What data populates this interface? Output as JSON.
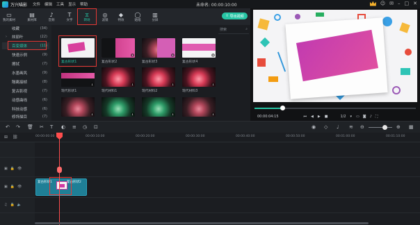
{
  "app": {
    "name": "万兴喵影",
    "menu": [
      "文件",
      "编辑",
      "工具",
      "显示",
      "帮助"
    ],
    "doc_title": "未命名: 00:00:10:00"
  },
  "toolbar": {
    "items": [
      {
        "label": "我的素材",
        "icon": "folder-icon"
      },
      {
        "label": "素材库",
        "icon": "library-icon"
      },
      {
        "label": "音频",
        "icon": "music-icon"
      },
      {
        "label": "文字",
        "icon": "text-icon"
      },
      {
        "label": "转场",
        "icon": "transition-icon"
      },
      {
        "label": "滤镜",
        "icon": "filter-icon"
      },
      {
        "label": "特效",
        "icon": "effects-icon"
      },
      {
        "label": "贴纸",
        "icon": "sticker-icon"
      },
      {
        "label": "分屏",
        "icon": "split-icon"
      }
    ],
    "active": "转场",
    "export_label": "导出视频"
  },
  "sidebar": {
    "items": [
      {
        "label": "收藏",
        "count": "(34)"
      },
      {
        "label": "炫丽叶",
        "count": "(22)"
      },
      {
        "label": "百变媒体",
        "count": "(11)",
        "selected": true
      },
      {
        "label": "快速示例",
        "count": "(9)"
      },
      {
        "label": "擦拭",
        "count": "(7)"
      },
      {
        "label": "水墨画风",
        "count": "(9)"
      },
      {
        "label": "隔离接帧",
        "count": "(8)"
      },
      {
        "label": "复古影视",
        "count": "(7)"
      },
      {
        "label": "动感曲线",
        "count": "(6)"
      },
      {
        "label": "科技动感",
        "count": "(6)"
      },
      {
        "label": "修饰描目",
        "count": "(7)"
      }
    ]
  },
  "library": {
    "search_placeholder": "搜索",
    "items": [
      {
        "label": "复古形状1",
        "selected": true
      },
      {
        "label": "复古形状2"
      },
      {
        "label": "复古形状3"
      },
      {
        "label": "复古形状4"
      },
      {
        "label": "现代形状1"
      },
      {
        "label": "现代材料1"
      },
      {
        "label": "现代材料2"
      },
      {
        "label": "现代材料3"
      },
      {
        "label": "现代材料4"
      },
      {
        "label": "现代材料5"
      },
      {
        "label": "现代材料6"
      }
    ]
  },
  "preview": {
    "time": "00:00:04:15",
    "page": "1/2",
    "progress": 0.17
  },
  "timeline": {
    "ruler": [
      "00:00:00:00",
      "00:00:10:00",
      "00:00:20:00",
      "00:00:30:00",
      "00:00:40:00",
      "00:00:50:00",
      "00:01:00:00",
      "00:01:10:00"
    ],
    "clip_labels": [
      "复古形状1",
      "复古形状2"
    ]
  },
  "colors": {
    "accent": "#26c6a6",
    "highlight": "#e53935",
    "clip": "#1f7f96"
  }
}
